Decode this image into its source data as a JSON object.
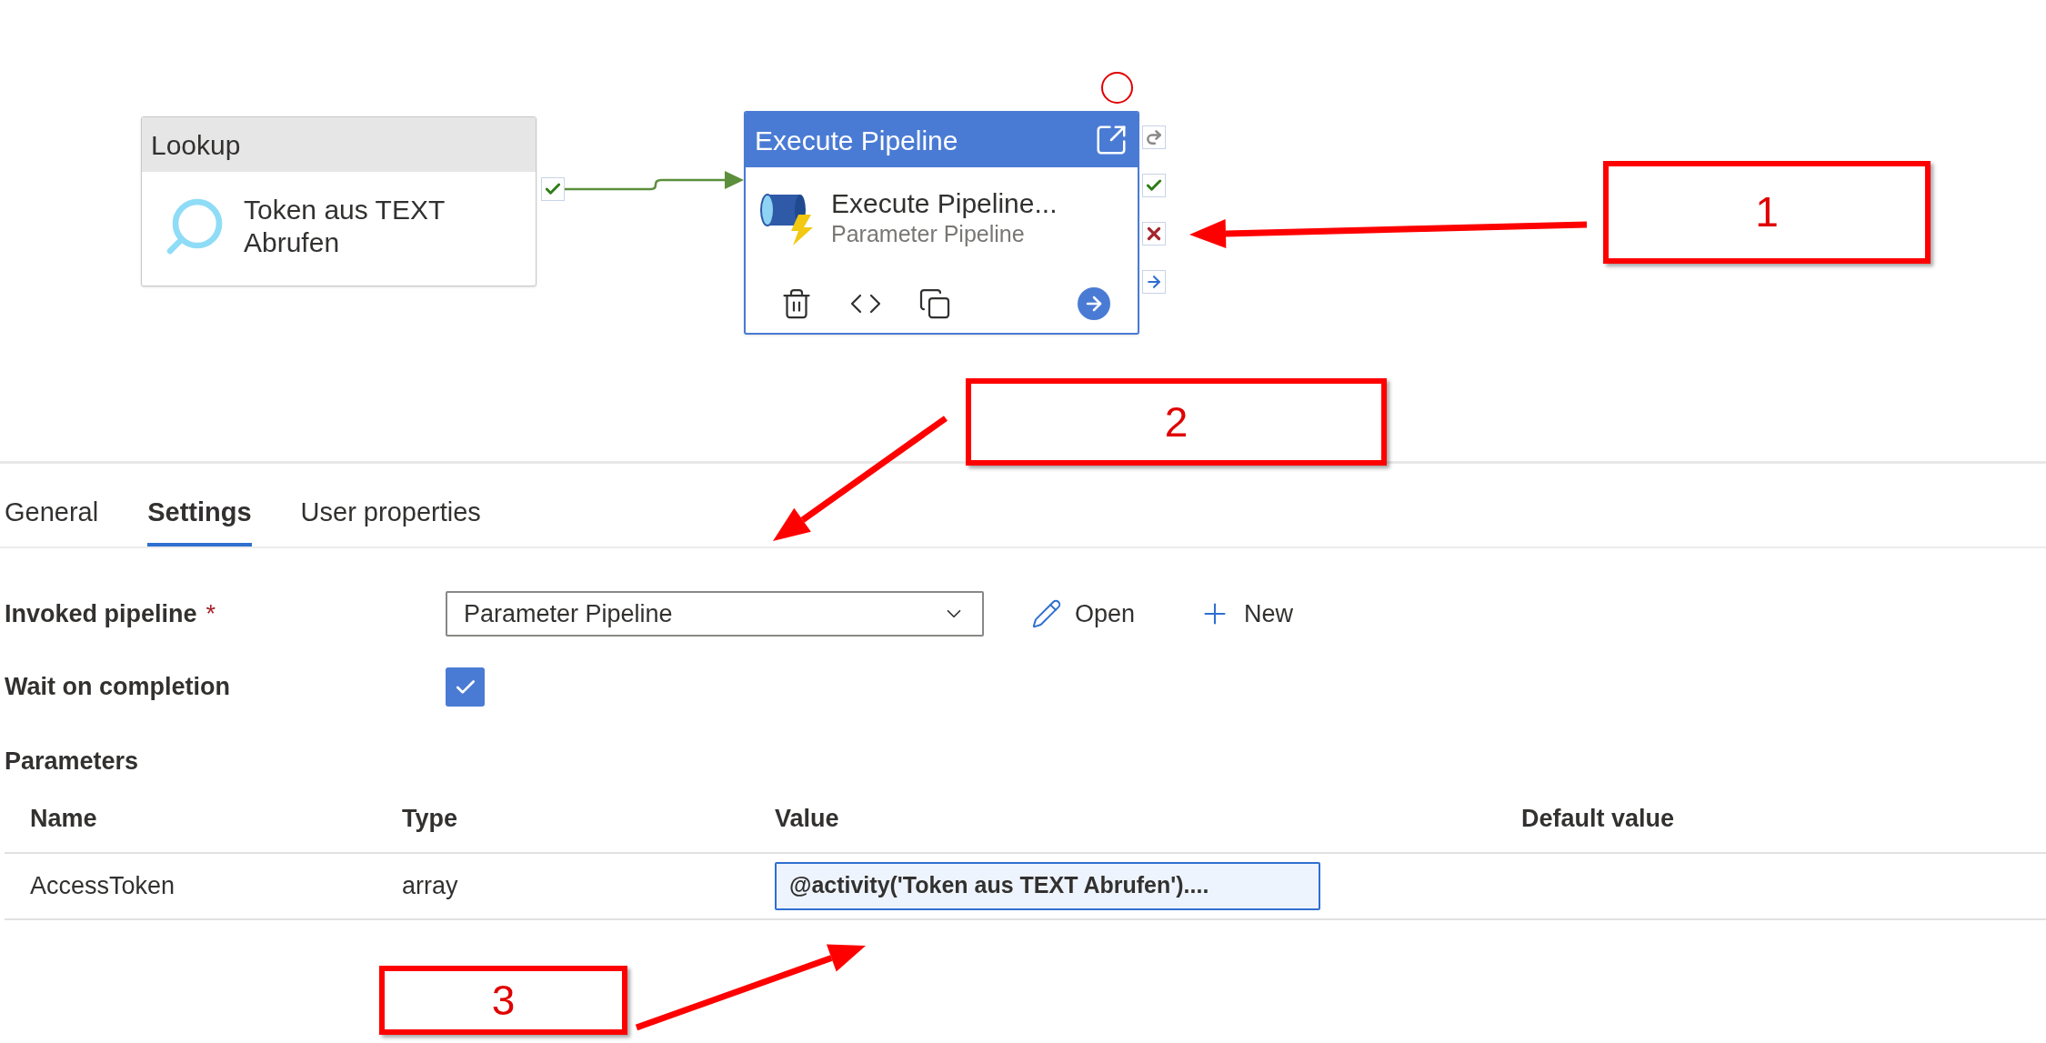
{
  "canvas": {
    "activities": [
      {
        "kind": "lookup",
        "header": "Lookup",
        "name": "Token aus TEXT Abrufen",
        "selected": false
      },
      {
        "kind": "execute_pipeline",
        "header": "Execute Pipeline",
        "name": "Execute Pipeline...",
        "subtitle": "Parameter Pipeline",
        "selected": true
      }
    ]
  },
  "annotations": [
    {
      "label": "1"
    },
    {
      "label": "2"
    },
    {
      "label": "3"
    }
  ],
  "tabs": [
    {
      "label": "General",
      "selected": false
    },
    {
      "label": "Settings",
      "selected": true
    },
    {
      "label": "User properties",
      "selected": false
    }
  ],
  "settings": {
    "invoked_pipeline": {
      "label": "Invoked pipeline",
      "required_mark": "*",
      "value": "Parameter Pipeline"
    },
    "actions": [
      {
        "kind": "edit",
        "label": "Open"
      },
      {
        "kind": "add",
        "label": "New"
      }
    ],
    "wait_on_completion": {
      "label": "Wait on completion",
      "checked": true
    },
    "parameters": {
      "title": "Parameters",
      "columns": [
        "Name",
        "Type",
        "Value",
        "Default value"
      ],
      "rows": [
        {
          "name": "AccessToken",
          "type": "array",
          "value": "@activity('Token aus TEXT Abrufen')...."
        }
      ]
    }
  }
}
